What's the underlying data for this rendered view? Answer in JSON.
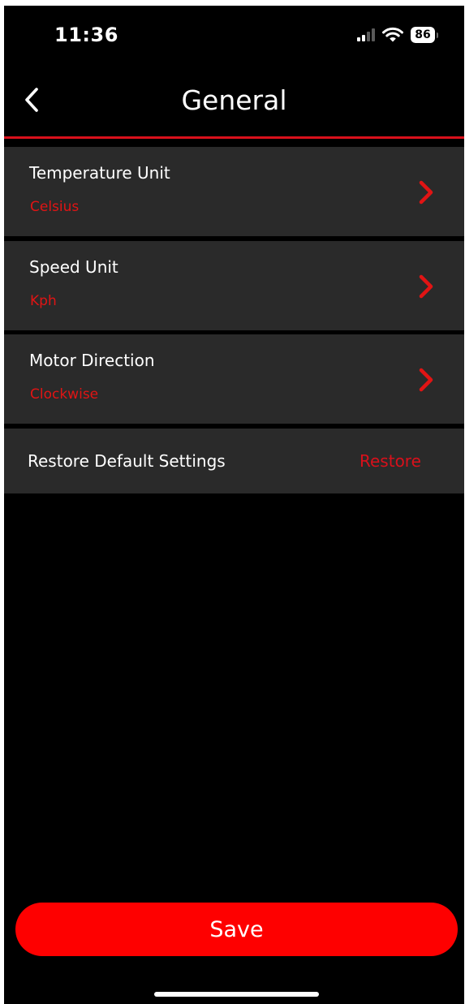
{
  "status_bar": {
    "time": "11:36",
    "battery": "86"
  },
  "header": {
    "title": "General"
  },
  "settings": [
    {
      "title": "Temperature Unit",
      "value": "Celsius"
    },
    {
      "title": "Speed Unit",
      "value": "Kph"
    },
    {
      "title": "Motor Direction",
      "value": "Clockwise"
    }
  ],
  "restore": {
    "label": "Restore Default Settings",
    "action": "Restore"
  },
  "save_button": {
    "label": "Save"
  },
  "colors": {
    "accent": "#e11414",
    "save_button": "#fe0000",
    "row_background": "#2a2a2a",
    "background": "#000000"
  },
  "icons": {
    "back": "chevron-left-icon",
    "row_arrow": "chevron-right-icon"
  }
}
